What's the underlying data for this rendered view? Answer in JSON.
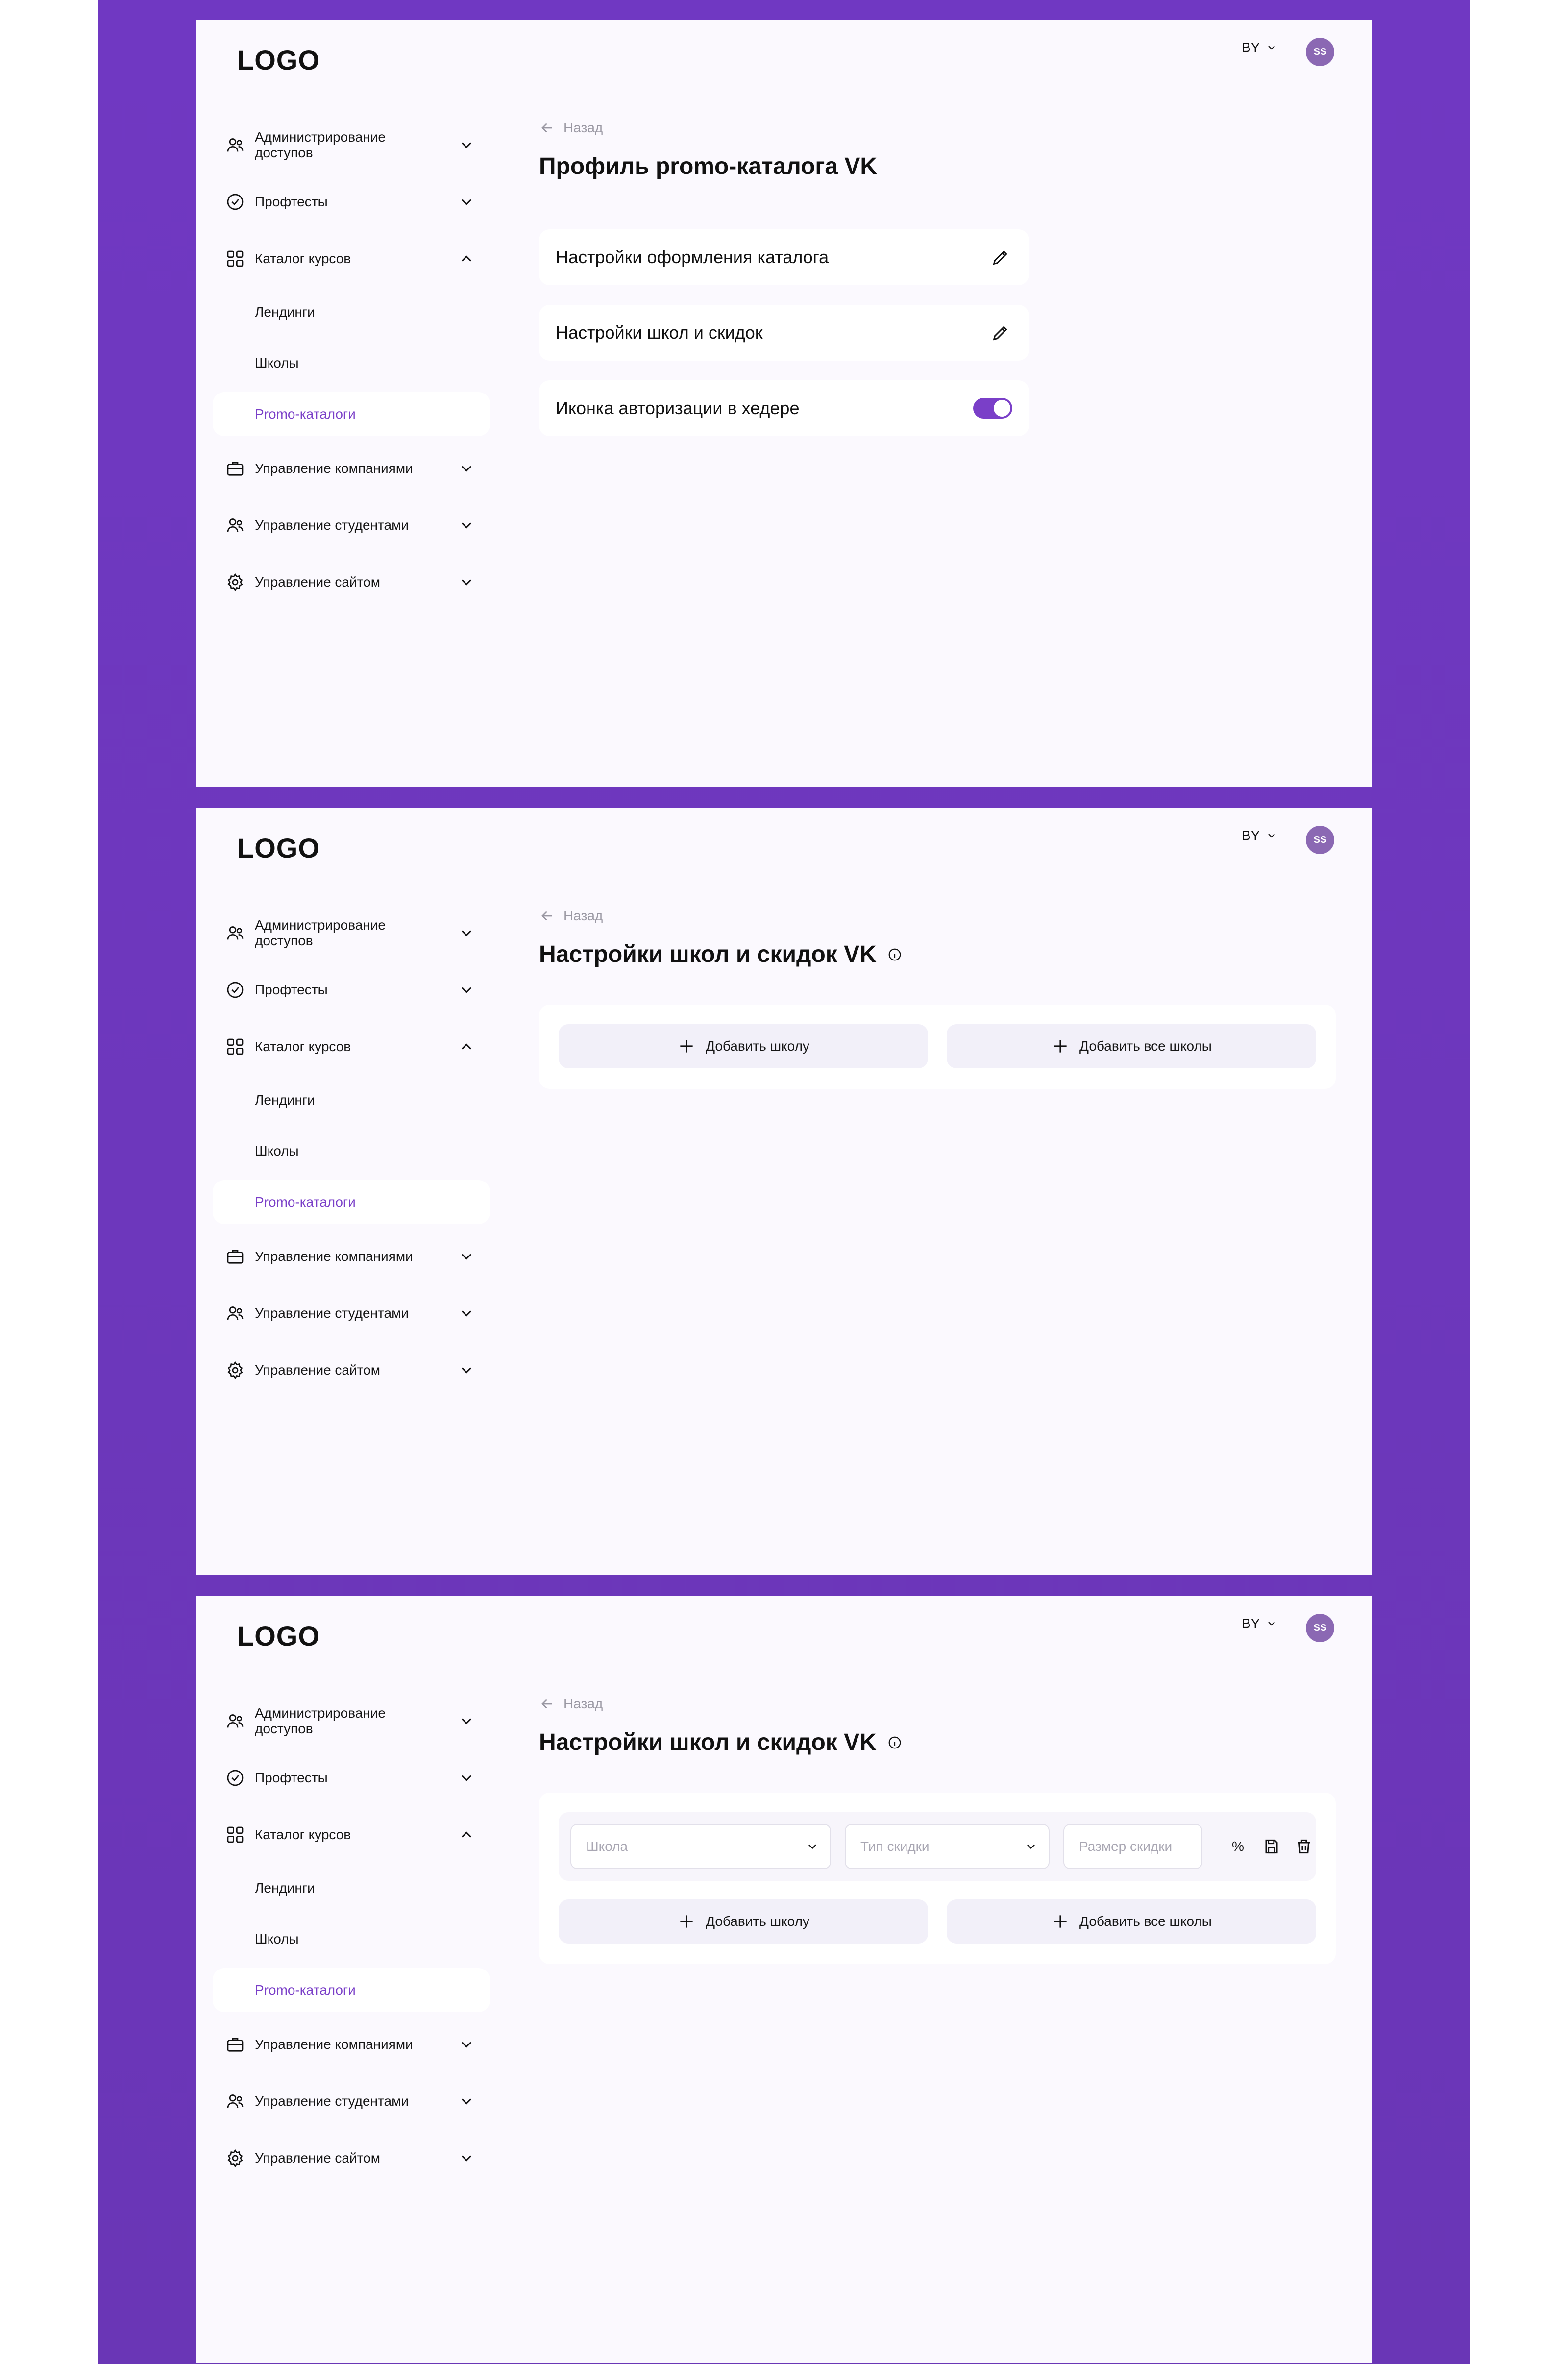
{
  "header": {
    "logo": "LOGO",
    "lang": "BY",
    "avatar": "SS"
  },
  "sidebar": {
    "items": [
      {
        "label": "Администрирование доступов"
      },
      {
        "label": "Профтесты"
      },
      {
        "label": "Каталог курсов"
      },
      {
        "label": "Управление компаниями"
      },
      {
        "label": "Управление студентами"
      },
      {
        "label": "Управление сайтом"
      }
    ],
    "sub_items": [
      {
        "label": "Лендинги"
      },
      {
        "label": "Школы"
      },
      {
        "label": "Promo-каталоги"
      }
    ]
  },
  "back_label": "Назад",
  "screen1": {
    "title": "Профиль promo-каталога VK",
    "cards": [
      {
        "label": "Настройки оформления каталога"
      },
      {
        "label": "Настройки школ и скидок"
      },
      {
        "label": "Иконка авторизации в хедере"
      }
    ],
    "toggle_on": true
  },
  "screen2": {
    "title": "Настройки школ и скидок VK",
    "add_school": "Добавить школу",
    "add_all": "Добавить все школы"
  },
  "screen3": {
    "title": "Настройки школ и скидок VK",
    "school_placeholder": "Школа",
    "discount_type_placeholder": "Тип скидки",
    "discount_size_placeholder": "Размер скидки",
    "percent": "%",
    "add_school": "Добавить школу",
    "add_all": "Добавить все школы"
  },
  "colors": {
    "background": "#7038c2",
    "accent": "#7a3fc8",
    "panel": "#fbf9fe"
  }
}
